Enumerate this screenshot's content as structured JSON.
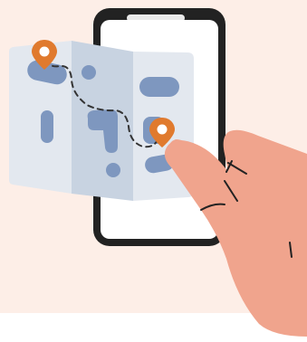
{
  "illustration": {
    "subject": "hand-holding-phone-with-map",
    "colors": {
      "background_panel": "#fdeee7",
      "page_background": "#ffffff",
      "phone_frame": "#222222",
      "phone_screen": "#ffffff",
      "map_light": "#e3e8ef",
      "map_mid": "#c8d3e1",
      "map_blocks": "#7e97bf",
      "route": "#333333",
      "pin": "#e07a2e",
      "skin": "#f0a48d",
      "skin_outline": "#222222"
    },
    "icons": [
      "location-pin-icon",
      "location-pin-icon"
    ]
  }
}
